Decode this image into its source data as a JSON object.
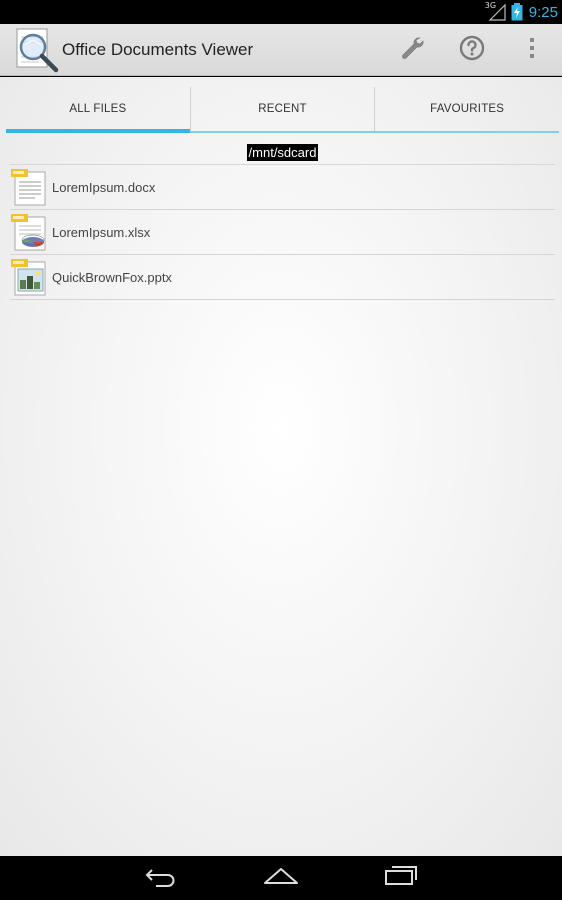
{
  "status_bar": {
    "network": "3G",
    "time": "9:25"
  },
  "action_bar": {
    "title": "Office Documents Viewer",
    "actions": [
      {
        "name": "settings",
        "icon": "wrench-icon"
      },
      {
        "name": "help",
        "icon": "help-icon"
      },
      {
        "name": "overflow",
        "icon": "overflow-menu-icon"
      }
    ]
  },
  "tabs": [
    {
      "label": "ALL FILES",
      "selected": true
    },
    {
      "label": "RECENT",
      "selected": false
    },
    {
      "label": "FAVOURITES",
      "selected": false
    }
  ],
  "current_path": "/mnt/sdcard",
  "files": [
    {
      "name": "LoremIpsum.docx",
      "type": "docx",
      "icon": "docx-file-icon"
    },
    {
      "name": "LoremIpsum.xlsx",
      "type": "xlsx",
      "icon": "xlsx-file-icon"
    },
    {
      "name": "QuickBrownFox.pptx",
      "type": "pptx",
      "icon": "pptx-file-icon"
    }
  ],
  "nav_bar": {
    "buttons": [
      "back-icon",
      "home-icon",
      "recent-apps-icon"
    ]
  },
  "colors": {
    "accent": "#33b5e5",
    "tab_indicator_light": "#7fd0ee",
    "action_bar_bg": "#e0e0e0"
  }
}
